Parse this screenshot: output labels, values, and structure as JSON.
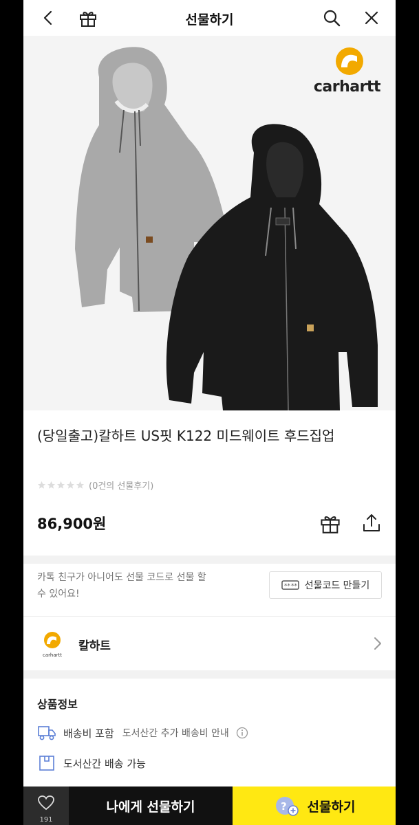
{
  "header": {
    "title": "선물하기",
    "icons": [
      "back-icon",
      "gift-box-icon",
      "search-icon",
      "close-icon"
    ]
  },
  "hero": {
    "brand_logo_text": "carhartt"
  },
  "product": {
    "title": "(당일출고)칼하트 US핏 K122 미드웨이트 후드집업",
    "rating_stars": 0,
    "review_text": "(0건의 선물후기)",
    "price": "86,900원"
  },
  "gift_code": {
    "note": "카톡 친구가 아니어도 선물 코드로 선물 할 수 있어요!",
    "button_label": "선물코드 만들기"
  },
  "brand": {
    "name": "칼하트",
    "logo_text": "carhartt"
  },
  "product_info": {
    "title": "상품정보",
    "shipping_label": "배송비 포함",
    "shipping_sub": "도서산간 추가 배송비 안내",
    "remote_label": "도서산간 배송 가능"
  },
  "bottom": {
    "wish_count": "191",
    "self_gift_label": "나에게 선물하기",
    "gift_label": "선물하기"
  },
  "colors": {
    "kakao_yellow": "#ffe812",
    "carhartt_orange": "#f2a900"
  }
}
